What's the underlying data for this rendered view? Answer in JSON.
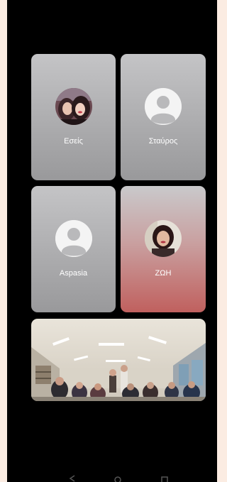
{
  "status_bar": {
    "left_text": "",
    "right_text": ""
  },
  "participants": [
    {
      "name": "Εσείς",
      "avatar": "photo-two-people-icon"
    },
    {
      "name": "Σταύρος",
      "avatar": "person-icon"
    },
    {
      "name": "Aspasia",
      "avatar": "person-icon"
    },
    {
      "name": "ΖΩΗ",
      "avatar": "photo-woman-icon"
    }
  ],
  "video_feed": {
    "type": "classroom-video"
  },
  "nav": {
    "back": "back-icon",
    "home": "home-icon",
    "recents": "recents-icon"
  },
  "colors": {
    "background": "#000000",
    "tile_gray": "#a8a8aa",
    "tile_red": "#c0605e",
    "page_margin": "#fbece2"
  }
}
